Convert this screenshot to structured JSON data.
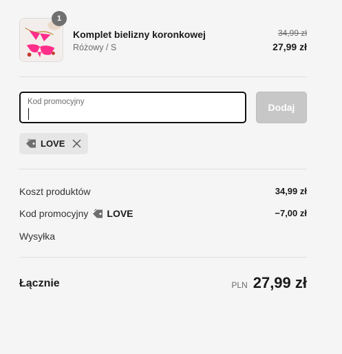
{
  "cart": {
    "item": {
      "quantity": "1",
      "name": "Komplet bielizny koronkowej",
      "variant": "Różowy / S",
      "price_original": "34,99 zł",
      "price_current": "27,99 zł"
    }
  },
  "promo": {
    "label": "Kod promocyjny",
    "input_value": "",
    "apply_label": "Dodaj",
    "applied_code": "LOVE"
  },
  "summary": {
    "subtotal_label": "Koszt produktów",
    "subtotal_value": "34,99 zł",
    "discount_label": "Kod promocyjny",
    "discount_code": "LOVE",
    "discount_value": "−7,00 zł",
    "shipping_label": "Wysyłka",
    "total_label": "Łącznie",
    "currency": "PLN",
    "total_value": "27,99 zł"
  },
  "colors": {
    "background": "#f6f5f5",
    "text": "#1a1a1a",
    "muted": "#6b6b6b",
    "button_disabled": "#c7c7c7",
    "chip_bg": "#e6e6e6",
    "product_pink": "#ff2e8a"
  },
  "icons": [
    "product-thumbnail",
    "tag-icon",
    "close-icon"
  ]
}
